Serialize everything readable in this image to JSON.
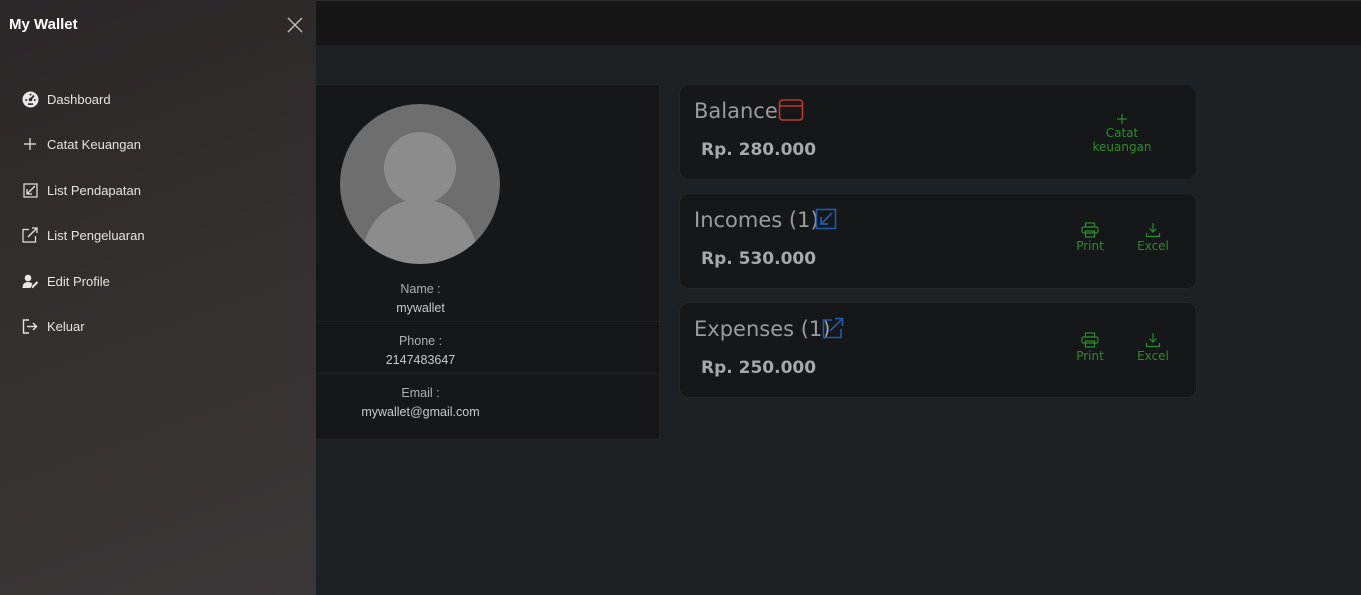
{
  "sidebar": {
    "title": "My Wallet",
    "items": [
      {
        "label": "Dashboard",
        "icon": "dashboard-icon"
      },
      {
        "label": "Catat Keuangan",
        "icon": "plus-icon"
      },
      {
        "label": "List Pendapatan",
        "icon": "incoming-arrow-icon"
      },
      {
        "label": "List Pengeluaran",
        "icon": "external-link-icon"
      },
      {
        "label": "Edit Profile",
        "icon": "user-edit-icon"
      },
      {
        "label": "Keluar",
        "icon": "logout-icon"
      }
    ]
  },
  "profile": {
    "name_label": "Name :",
    "name": "mywallet",
    "phone_label": "Phone :",
    "phone": "2147483647",
    "email_label": "Email :",
    "email": "mywallet@gmail.com"
  },
  "balance": {
    "title": "Balance",
    "amount": "Rp. 280.000",
    "action_label": "Catat keuangan",
    "icon": "wallet-icon",
    "icon_color": "#c0392b"
  },
  "incomes": {
    "title": "Incomes (1)",
    "amount": "Rp. 530.000",
    "print_label": "Print",
    "excel_label": "Excel",
    "icon": "incoming-arrow-icon",
    "icon_color": "#1e5aa8"
  },
  "expenses": {
    "title": "Expenses (1)",
    "amount": "Rp. 250.000",
    "print_label": "Print",
    "excel_label": "Excel",
    "icon": "external-link-icon",
    "icon_color": "#1e5aa8"
  },
  "colors": {
    "action_green": "#2e8b2e",
    "drawer_bg": "#332f30",
    "page_bg": "#1e2124"
  }
}
